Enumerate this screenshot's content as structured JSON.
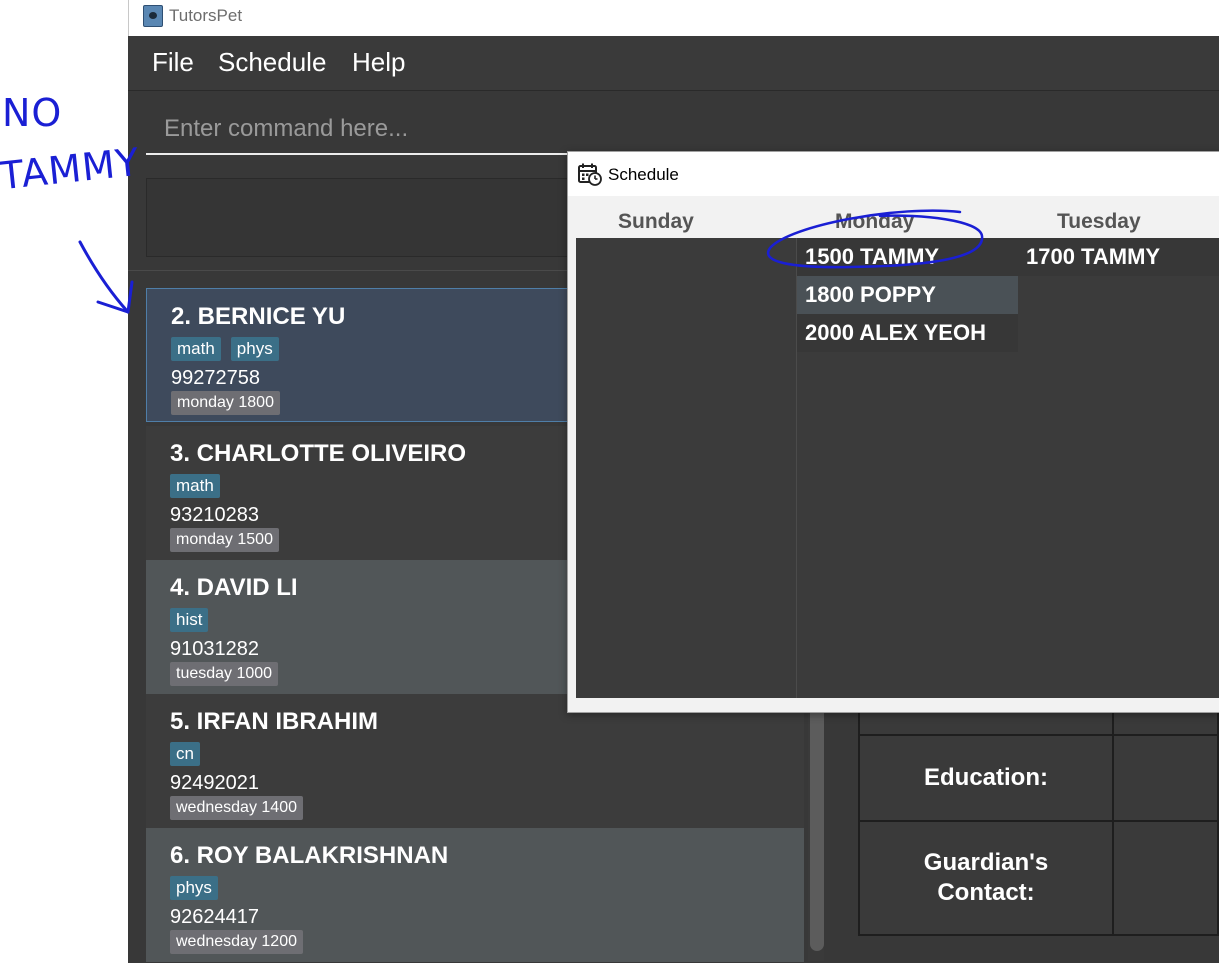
{
  "app": {
    "title": "TutorsPet"
  },
  "menu": [
    "File",
    "Schedule",
    "Help"
  ],
  "command": {
    "placeholder": "Enter command here..."
  },
  "persons": [
    {
      "index_name": "2.  BERNICE YU",
      "tags": [
        "math",
        "phys"
      ],
      "phone": "99272758",
      "lesson": "monday 1800"
    },
    {
      "index_name": "3.  CHARLOTTE OLIVEIRO",
      "tags": [
        "math"
      ],
      "phone": "93210283",
      "lesson": "monday 1500"
    },
    {
      "index_name": "4.  DAVID LI",
      "tags": [
        "hist"
      ],
      "phone": "91031282",
      "lesson": "tuesday 1000"
    },
    {
      "index_name": "5.  IRFAN IBRAHIM",
      "tags": [
        "cn"
      ],
      "phone": "92492021",
      "lesson": "wednesday 1400"
    },
    {
      "index_name": "6.  ROY BALAKRISHNAN",
      "tags": [
        "phys"
      ],
      "phone": "92624417",
      "lesson": "wednesday 1200"
    }
  ],
  "details": {
    "education_label": "Education:",
    "guardian_label": "Guardian's\nContact:"
  },
  "schedule": {
    "title": "Schedule",
    "days": [
      "Sunday",
      "Monday",
      "Tuesday"
    ],
    "monday": [
      "1500 TAMMY",
      "1800 POPPY",
      "2000 ALEX YEOH"
    ],
    "tuesday": [
      "1700 TAMMY"
    ]
  },
  "annotation": {
    "line1": "NO",
    "line2": "TAMMY"
  },
  "colors": {
    "annotation_ink": "#1a1fd4",
    "tag": "#3b6f87",
    "lesson_badge": "#6e6e73",
    "selected_border": "#4f7ea8"
  }
}
